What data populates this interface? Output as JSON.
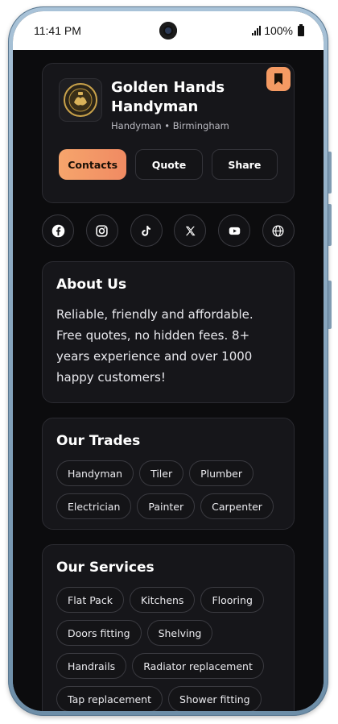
{
  "status_bar": {
    "time": "11:41 PM",
    "battery": "100%"
  },
  "business": {
    "name": "Golden Hands Handyman",
    "subtitle": "Handyman • Birmingham",
    "logo_icon": "golden-hands-logo"
  },
  "actions": {
    "contacts": "Contacts",
    "quote": "Quote",
    "share": "Share"
  },
  "social": [
    {
      "icon": "facebook-icon"
    },
    {
      "icon": "instagram-icon"
    },
    {
      "icon": "tiktok-icon"
    },
    {
      "icon": "x-icon"
    },
    {
      "icon": "youtube-icon"
    },
    {
      "icon": "globe-icon"
    }
  ],
  "about": {
    "title": "About Us",
    "text": "Reliable, friendly and affordable. Free quotes, no hidden fees. 8+ years experience and over 1000 happy customers!"
  },
  "trades": {
    "title": "Our Trades",
    "items": [
      "Handyman",
      "Tiler",
      "Plumber",
      "Electrician",
      "Painter",
      "Carpenter"
    ]
  },
  "services": {
    "title": "Our Services",
    "items": [
      "Flat Pack",
      "Kitchens",
      "Flooring",
      "Doors fitting",
      "Shelving",
      "Handrails",
      "Radiator replacement",
      "Tap replacement",
      "Shower fitting"
    ]
  },
  "colors": {
    "accent": "#f49a63",
    "background": "#0c0c0e",
    "card": "#16161a"
  }
}
